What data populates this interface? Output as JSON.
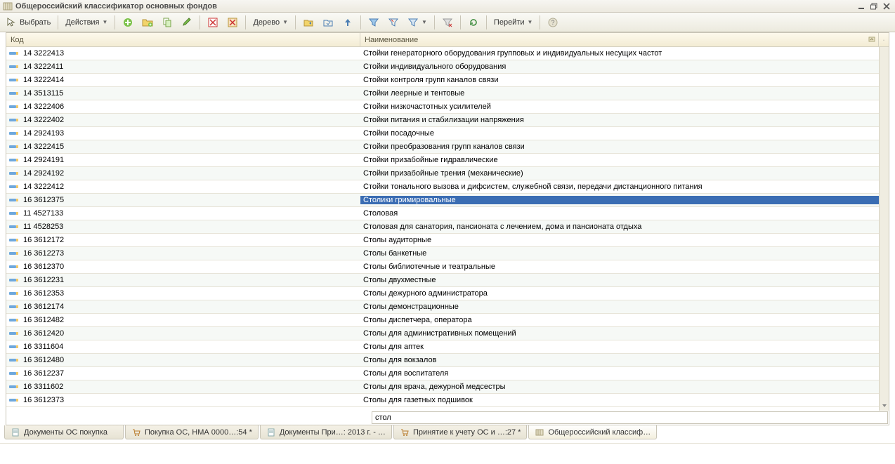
{
  "window": {
    "title": "Общероссийский классификатор основных фондов"
  },
  "toolbar": {
    "select": "Выбрать",
    "actions": "Действия",
    "tree": "Дерево",
    "goto": "Перейти"
  },
  "columns": {
    "code": "Код",
    "name": "Наименование"
  },
  "search": {
    "value": "стол"
  },
  "rows": [
    {
      "code": "14 3222413",
      "name": "Стойки генераторного оборудования групповых и индивидуальных несущих частот",
      "sel": false
    },
    {
      "code": "14 3222411",
      "name": "Стойки индивидуального оборудования",
      "sel": false
    },
    {
      "code": "14 3222414",
      "name": "Стойки контроля групп каналов связи",
      "sel": false
    },
    {
      "code": "14 3513115",
      "name": "Стойки леерные и тентовые",
      "sel": false
    },
    {
      "code": "14 3222406",
      "name": "Стойки низкочастотных усилителей",
      "sel": false
    },
    {
      "code": "14 3222402",
      "name": "Стойки питания и стабилизации напряжения",
      "sel": false
    },
    {
      "code": "14 2924193",
      "name": "Стойки посадочные",
      "sel": false
    },
    {
      "code": "14 3222415",
      "name": "Стойки преобразования групп каналов связи",
      "sel": false
    },
    {
      "code": "14 2924191",
      "name": "Стойки призабойные гидравлические",
      "sel": false
    },
    {
      "code": "14 2924192",
      "name": "Стойки призабойные трения (механические)",
      "sel": false
    },
    {
      "code": "14 3222412",
      "name": "Стойки тонального вызова и дифсистем, служебной связи, передачи дистанционного питания",
      "sel": false
    },
    {
      "code": "16 3612375",
      "name": "Столики гримировальные",
      "sel": true
    },
    {
      "code": "11 4527133",
      "name": "Столовая",
      "sel": false
    },
    {
      "code": "11 4528253",
      "name": "Столовая для санатория, пансионата с лечением, дома и пансионата отдыха",
      "sel": false
    },
    {
      "code": "16 3612172",
      "name": "Столы аудиторные",
      "sel": false
    },
    {
      "code": "16 3612273",
      "name": "Столы банкетные",
      "sel": false
    },
    {
      "code": "16 3612370",
      "name": "Столы библиотечные и театральные",
      "sel": false
    },
    {
      "code": "16 3612231",
      "name": "Столы двухместные",
      "sel": false
    },
    {
      "code": "16 3612353",
      "name": "Столы дежурного администратора",
      "sel": false
    },
    {
      "code": "16 3612174",
      "name": "Столы демонстрационные",
      "sel": false
    },
    {
      "code": "16 3612482",
      "name": "Столы диспетчера, оператора",
      "sel": false
    },
    {
      "code": "16 3612420",
      "name": "Столы для административных помещений",
      "sel": false
    },
    {
      "code": "16 3311604",
      "name": "Столы для аптек",
      "sel": false
    },
    {
      "code": "16 3612480",
      "name": "Столы для вокзалов",
      "sel": false
    },
    {
      "code": "16 3612237",
      "name": "Столы для воспитателя",
      "sel": false
    },
    {
      "code": "16 3311602",
      "name": "Столы для врача, дежурной медсестры",
      "sel": false
    },
    {
      "code": "16 3612373",
      "name": "Столы для газетных подшивок",
      "sel": false
    }
  ],
  "tabs": [
    {
      "label": "Документы ОС покупка",
      "icon": "doc",
      "active": false
    },
    {
      "label": "Покупка ОС, НМА 0000…:54 *",
      "icon": "cart",
      "active": false
    },
    {
      "label": "Документы При…: 2013 г. - …",
      "icon": "doc",
      "active": false
    },
    {
      "label": "Принятие к учету ОС и …:27 *",
      "icon": "cart",
      "active": false
    },
    {
      "label": "Общероссийский классиф…",
      "icon": "grid",
      "active": true
    }
  ]
}
